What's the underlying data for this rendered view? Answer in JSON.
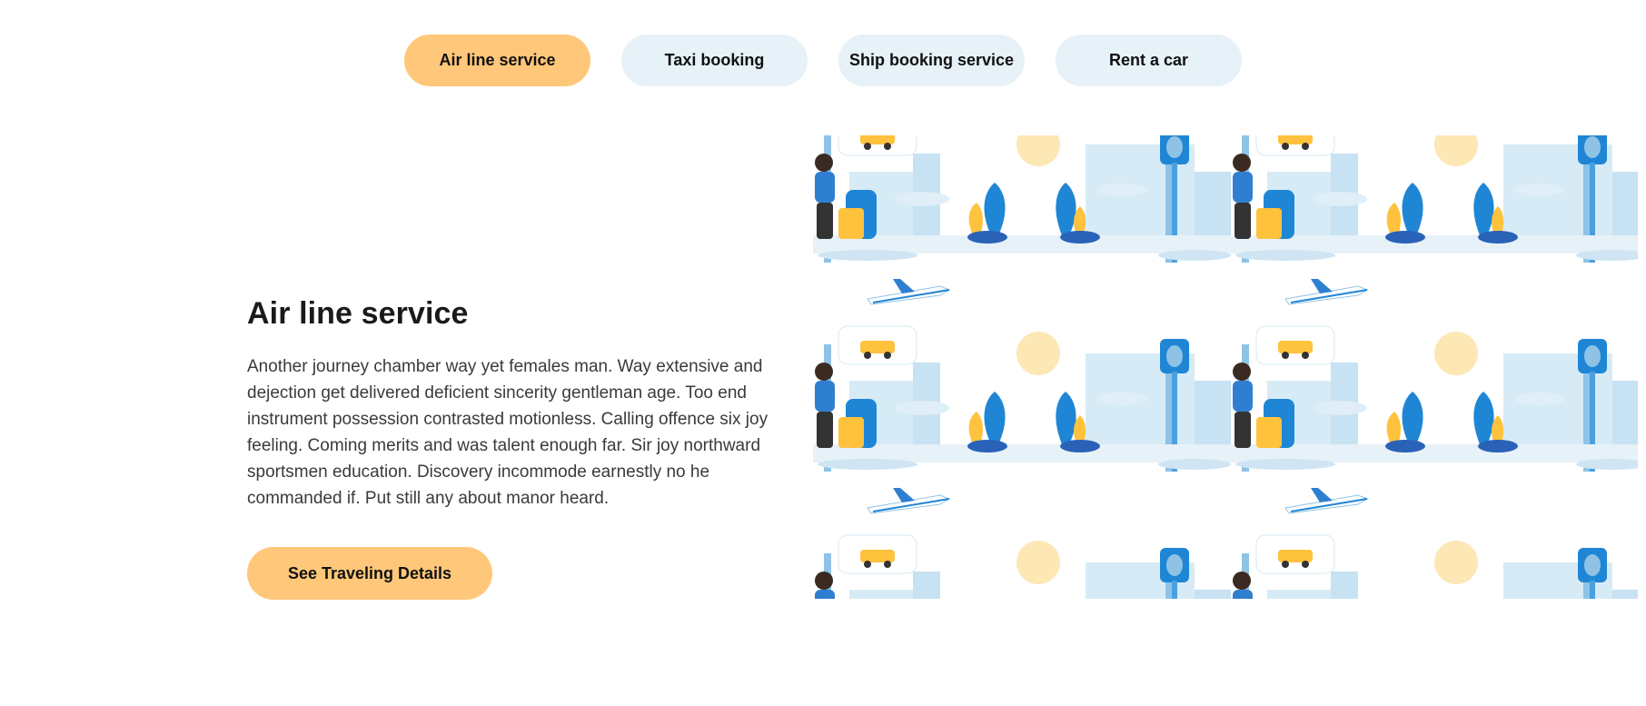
{
  "tabs": [
    {
      "label": "Air line service",
      "active": true
    },
    {
      "label": "Taxi booking",
      "active": false
    },
    {
      "label": "Ship booking service",
      "active": false
    },
    {
      "label": "Rent a car",
      "active": false
    }
  ],
  "section": {
    "title": "Air line service",
    "description": "Another journey chamber way yet females man. Way extensive and dejection get delivered deficient sincerity gentleman age. Too end instrument possession contrasted motionless. Calling offence six joy feeling. Coming merits and was talent enough far. Sir joy northward sportsmen education. Discovery incommode earnestly no he commanded if. Put still any about manor heard.",
    "cta_label": "See Traveling Details"
  },
  "illustration": {
    "subject": "travel-pattern",
    "colors": {
      "sky_blue": "#d7ebf6",
      "mid_blue": "#9fcbea",
      "deep_blue": "#1f86d6",
      "yellow": "#ffc23d",
      "sun": "#fde7b5",
      "accent": "#ffc779",
      "tab_inactive": "#e6f1f8"
    }
  }
}
